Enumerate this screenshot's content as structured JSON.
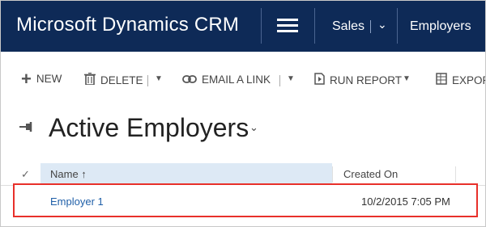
{
  "header": {
    "app_title": "Microsoft Dynamics CRM",
    "nav": {
      "area": "Sales",
      "entity": "Employers"
    }
  },
  "command_bar": {
    "new_label": "NEW",
    "delete_label": "DELETE",
    "email_link_label": "EMAIL A LINK",
    "run_report_label": "RUN REPORT",
    "export_label": "EXPOR"
  },
  "view": {
    "title": "Active Employers"
  },
  "grid": {
    "columns": [
      "Name ↑",
      "Created On"
    ],
    "rows": [
      {
        "name": "Employer 1",
        "created_on": "10/2/2015 7:05 PM"
      }
    ]
  },
  "colors": {
    "nav_background": "#0e2a57",
    "selected_header": "#dde9f5",
    "link": "#1f5fa8",
    "highlight_border": "#e8302a"
  },
  "icons": {
    "menu": "hamburger-icon",
    "new": "plus-icon",
    "delete": "trash-icon",
    "email": "link-icon",
    "report": "report-icon",
    "export": "excel-icon",
    "pin": "pin-icon"
  }
}
